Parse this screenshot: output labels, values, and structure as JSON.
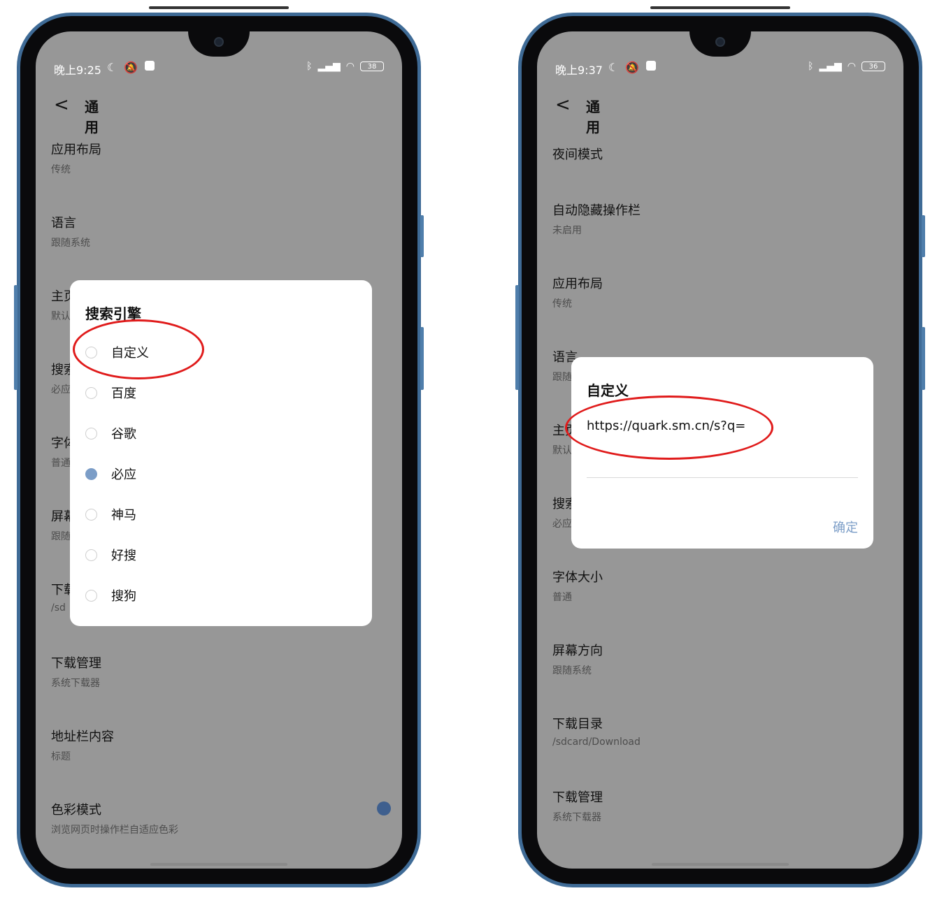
{
  "left": {
    "status": {
      "time": "晚上9:25",
      "battery": "38"
    },
    "header": {
      "back": "<",
      "title": "通用"
    },
    "items": [
      {
        "title": "应用布局",
        "sub": "传统"
      },
      {
        "title": "语言",
        "sub": "跟随系统"
      },
      {
        "title": "主页",
        "sub": "默认"
      },
      {
        "title": "搜索",
        "sub": "必应"
      },
      {
        "title": "字体",
        "sub": "普通"
      },
      {
        "title": "屏幕",
        "sub": "跟随"
      },
      {
        "title": "下载",
        "sub": "/sd"
      },
      {
        "title": "下载管理",
        "sub": "系统下载器"
      },
      {
        "title": "地址栏内容",
        "sub": "标题"
      },
      {
        "title": "色彩模式",
        "sub": "浏览网页时操作栏自适应色彩"
      }
    ],
    "dialog": {
      "title": "搜索引擎",
      "options": [
        {
          "label": "自定义",
          "selected": false
        },
        {
          "label": "百度",
          "selected": false
        },
        {
          "label": "谷歌",
          "selected": false
        },
        {
          "label": "必应",
          "selected": true
        },
        {
          "label": "神马",
          "selected": false
        },
        {
          "label": "好搜",
          "selected": false
        },
        {
          "label": "搜狗",
          "selected": false
        }
      ]
    }
  },
  "right": {
    "status": {
      "time": "晚上9:37",
      "battery": "36"
    },
    "header": {
      "back": "<",
      "title": "通用"
    },
    "items": [
      {
        "title": "夜间模式",
        "sub": ""
      },
      {
        "title": "自动隐藏操作栏",
        "sub": "未启用"
      },
      {
        "title": "应用布局",
        "sub": "传统"
      },
      {
        "title": "语言",
        "sub": "跟随系统"
      },
      {
        "title": "主页",
        "sub": "默认"
      },
      {
        "title": "搜索",
        "sub": "必应"
      },
      {
        "title": "字体大小",
        "sub": "普通"
      },
      {
        "title": "屏幕方向",
        "sub": "跟随系统"
      },
      {
        "title": "下载目录",
        "sub": "/sdcard/Download"
      },
      {
        "title": "下载管理",
        "sub": "系统下载器"
      }
    ],
    "dialog": {
      "title": "自定义",
      "input_value": "https://quark.sm.cn/s?q=",
      "confirm": "确定"
    }
  },
  "colors": {
    "scrim": "#979797",
    "accent": "#7b9dc7",
    "highlight": "#e01b1b",
    "frame": "#3f6b96"
  }
}
